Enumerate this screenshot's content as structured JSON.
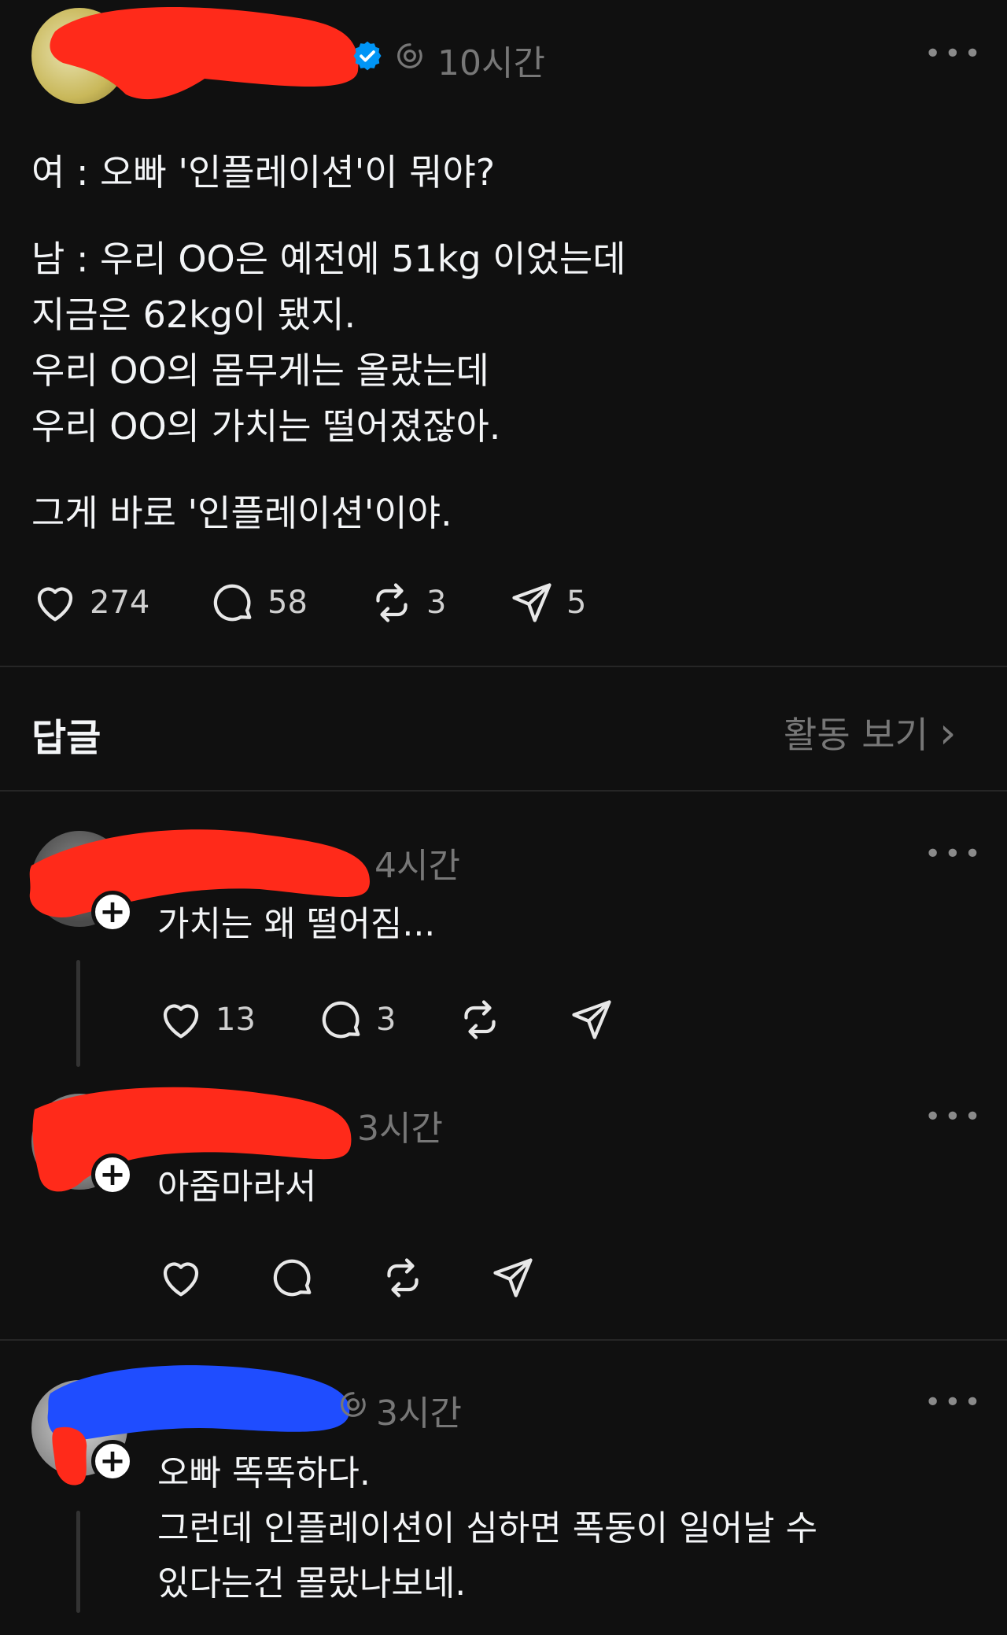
{
  "post": {
    "time": "10시간",
    "more": "•••",
    "paragraphs": [
      [
        "여 : 오빠 '인플레이션'이 뭐야?"
      ],
      [
        "남 : 우리 OO은 예전에 51kg 이었는데",
        "지금은 62kg이 됐지.",
        "우리 OO의 몸무게는 올랐는데",
        "우리 OO의 가치는 떨어졌잖아."
      ],
      [
        "그게 바로 '인플레이션'이야."
      ]
    ],
    "actions": {
      "likes": "274",
      "comments": "58",
      "reposts": "3",
      "shares": "5"
    }
  },
  "replies_header": {
    "title": "답글",
    "activity": "활동 보기",
    "chevron": "›"
  },
  "replies": [
    {
      "time": "4시간",
      "text": "가치는 왜 떨어짐...",
      "likes": "13",
      "comments": "3"
    },
    {
      "time": "3시간",
      "text": "아줌마라서"
    },
    {
      "time": "3시간",
      "lines": [
        "오빠 똑똑하다.",
        "그런데 인플레이션이 심하면 폭동이 일어날 수",
        "있다는건 몰랐나보네."
      ]
    }
  ],
  "colors": {
    "background": "#101010",
    "text": "#f3f5f7",
    "muted": "#777777",
    "verified": "#0095f6",
    "redact_red": "#ff2a1a",
    "redact_blue": "#1f4dff"
  },
  "icons": [
    "heart-icon",
    "comment-icon",
    "repost-icon",
    "share-icon",
    "verified-icon",
    "threads-icon",
    "plus-icon",
    "chevron-right-icon"
  ]
}
